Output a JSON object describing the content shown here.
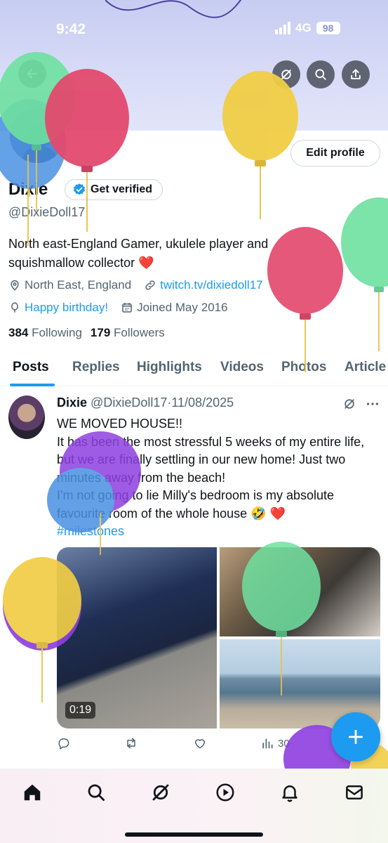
{
  "status_bar": {
    "time": "9:42",
    "network": "4G",
    "battery": "98"
  },
  "header_actions": [
    "back-icon",
    "grok-icon",
    "search-icon",
    "share-icon"
  ],
  "profile": {
    "name": "Dixie",
    "get_verified": "Get verified",
    "handle": "@DixieDoll17",
    "edit_profile": "Edit profile",
    "bio_line1": "North east-England Gamer, ukulele player and",
    "bio_line2": "squishmallow collector ❤️",
    "location": "North East, England",
    "website": "twitch.tv/dixiedoll17",
    "birthday": "Happy birthday!",
    "joined": "Joined May 2016",
    "following_count": "384",
    "following_label": "Following",
    "followers_count": "179",
    "followers_label": "Followers"
  },
  "tabs": [
    "Posts",
    "Replies",
    "Highlights",
    "Videos",
    "Photos",
    "Article"
  ],
  "post": {
    "author": "Dixie",
    "handle": "@DixieDoll17",
    "separator": "·",
    "date": "11/08/2025",
    "line1": "WE MOVED HOUSE!!",
    "line2": "It has been the most stressful 5 weeks of my entire life, but we are finally settling in our new home! Just two minutes away from the beach!",
    "line3": "I'm not going to lie Milly's bedroom is my absolute favourite room of the whole house 🤣 ❤️",
    "hashtag": "#milestones",
    "video_duration": "0:19",
    "views": "30"
  },
  "colors": {
    "accent": "#1d9bf0",
    "text": "#0f1419",
    "secondary": "#536471"
  }
}
